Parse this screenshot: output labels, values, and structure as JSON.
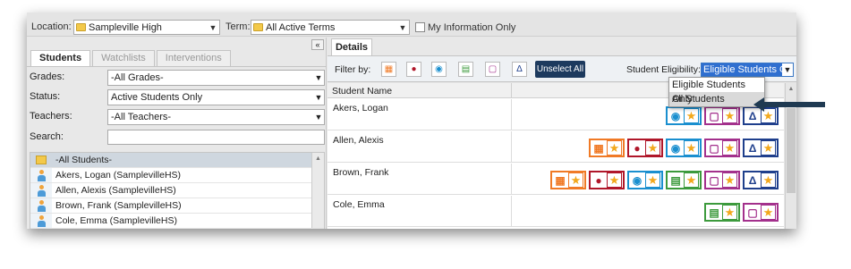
{
  "topbar": {
    "location_label": "Location:",
    "location_value": "Sampleville High",
    "term_label": "Term:",
    "term_value": "All Active Terms",
    "myinfo_label": "My Information Only"
  },
  "left": {
    "collapse_icon": "«",
    "tabs": [
      "Students",
      "Watchlists",
      "Interventions"
    ],
    "filters": {
      "grades_label": "Grades:",
      "grades_value": "-All Grades-",
      "status_label": "Status:",
      "status_value": "Active Students Only",
      "teachers_label": "Teachers:",
      "teachers_value": "-All Teachers-",
      "search_label": "Search:"
    },
    "list": {
      "all_label": "-All Students-",
      "items": [
        "Akers, Logan (SamplevilleHS)",
        "Allen, Alexis (SamplevilleHS)",
        "Brown, Frank (SamplevilleHS)",
        "Cole, Emma (SamplevilleHS)"
      ]
    }
  },
  "right": {
    "details_tab": "Details",
    "filter_by_label": "Filter by:",
    "unselect_label": "Unselect All",
    "eligibility_label": "Student Eligibility:",
    "eligibility_value": "Eligible Students O",
    "dropdown_options": [
      "Eligible Students Only",
      "All Students"
    ],
    "column_header": "Student Name",
    "students": [
      {
        "name": "Akers, Logan",
        "badges": [
          "globe",
          "book",
          "science"
        ]
      },
      {
        "name": "Allen, Alexis",
        "badges": [
          "calendar",
          "person",
          "globe",
          "book",
          "science"
        ]
      },
      {
        "name": "Brown, Frank",
        "badges": [
          "calendar",
          "person",
          "globe",
          "calculator",
          "book",
          "science"
        ]
      },
      {
        "name": "Cole, Emma",
        "badges": [
          "calculator",
          "book"
        ]
      }
    ]
  },
  "colors": {
    "calendar": "#f07a26",
    "person": "#b0172a",
    "globe": "#1a8fcf",
    "calculator": "#3c9a3c",
    "book": "#a3308c",
    "science": "#1f3f8c",
    "star": "#f2a81c",
    "accent": "#1d3a5e"
  }
}
